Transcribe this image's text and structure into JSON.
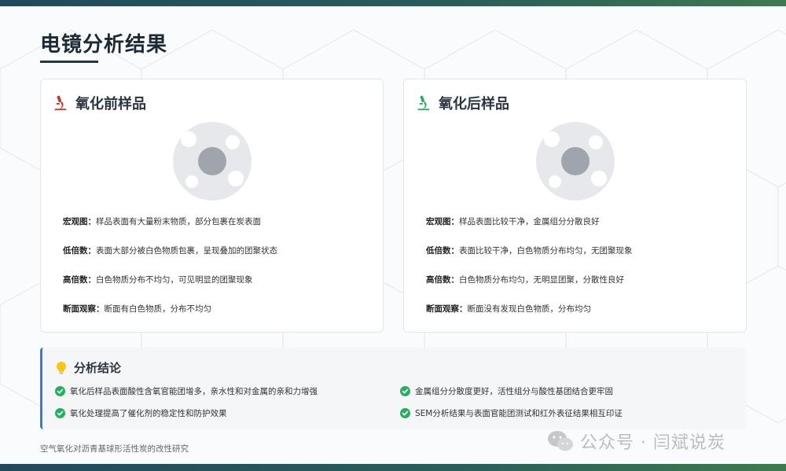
{
  "page": {
    "title": "电镜分析结果",
    "footer": "空气氧化对沥青基球形活性炭的改性研究"
  },
  "cards": [
    {
      "title": "氧化前样品",
      "icon": "microscope-icon",
      "icon_color": "#c0392b",
      "rows": [
        {
          "label": "宏观图：",
          "text": "样品表面有大量粉末物质，部分包裹在炭表面"
        },
        {
          "label": "低倍数：",
          "text": "表面大部分被白色物质包裹，呈现叠加的团聚状态"
        },
        {
          "label": "高倍数：",
          "text": "白色物质分布不均匀，可见明显的团聚现象"
        },
        {
          "label": "断面观察：",
          "text": "断面有白色物质，分布不均匀"
        }
      ]
    },
    {
      "title": "氧化后样品",
      "icon": "microscope-icon",
      "icon_color": "#27ae60",
      "rows": [
        {
          "label": "宏观图：",
          "text": "样品表面比较干净，金属组分分散良好"
        },
        {
          "label": "低倍数：",
          "text": "表面比较干净，白色物质分布均匀，无团聚现象"
        },
        {
          "label": "高倍数：",
          "text": "白色物质分布均匀，无明显团聚，分散性良好"
        },
        {
          "label": "断面观察：",
          "text": "断面没有发现白色物质，分布均匀"
        }
      ]
    }
  ],
  "conclusion": {
    "title": "分析结论",
    "icon": "lightbulb-icon",
    "items": [
      "氧化后样品表面酸性含氧官能团增多，亲水性和对金属的亲和力增强",
      "金属组分分散度更好，活性组分与酸性基团结合更牢固",
      "氧化处理提高了催化剂的稳定性和防护效果",
      "SEM分析结果与表面官能团测试和红外表征结果相互印证"
    ]
  },
  "watermark": {
    "text": "公众号 · 闫斌说炭",
    "icon": "wechat-icon"
  },
  "colors": {
    "accent": "#3a7bd5",
    "check": "#27ae60",
    "bar": "#1f4a5c"
  }
}
